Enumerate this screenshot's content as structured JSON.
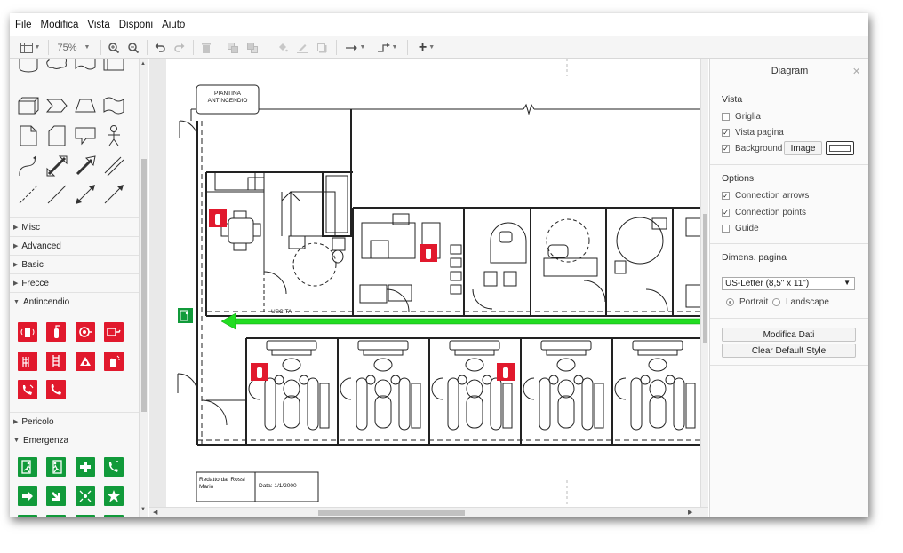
{
  "menu": [
    "File",
    "Modifica",
    "Vista",
    "Disponi",
    "Aiuto"
  ],
  "toolbar": {
    "zoom": "75%"
  },
  "sidebar": {
    "sections": [
      {
        "label": "Misc",
        "expanded": false
      },
      {
        "label": "Advanced",
        "expanded": false
      },
      {
        "label": "Basic",
        "expanded": false
      },
      {
        "label": "Frecce",
        "expanded": false
      },
      {
        "label": "Antincendio",
        "expanded": true
      },
      {
        "label": "Pericolo",
        "expanded": false
      },
      {
        "label": "Emergenza",
        "expanded": true
      }
    ]
  },
  "diagram": {
    "title_box": "PIANTINA\nANTINCENDIO",
    "exit_label": "USCITA",
    "author_label": "Redatto da: Rossi\nMario",
    "date_label": "Data: 1/1/2000"
  },
  "panel": {
    "title": "Diagram",
    "vista_heading": "Vista",
    "griglia": "Griglia",
    "vista_pagina": "Vista pagina",
    "background": "Background",
    "image_button": "Image",
    "options_heading": "Options",
    "connection_arrows": "Connection arrows",
    "connection_points": "Connection points",
    "guide": "Guide",
    "page_size_heading": "Dimens. pagina",
    "page_size_value": "US-Letter (8,5\" x 11\")",
    "portrait": "Portrait",
    "landscape": "Landscape",
    "modifica_dati": "Modifica Dati",
    "clear_default_style": "Clear Default Style",
    "checks": {
      "griglia": false,
      "vista_pagina": true,
      "background": true,
      "connection_arrows": true,
      "connection_points": true,
      "guide": false
    },
    "orientation": "Portrait"
  },
  "colors": {
    "fire": "#e1192d",
    "emergency": "#119a3a",
    "arrow": "#22dd22"
  }
}
